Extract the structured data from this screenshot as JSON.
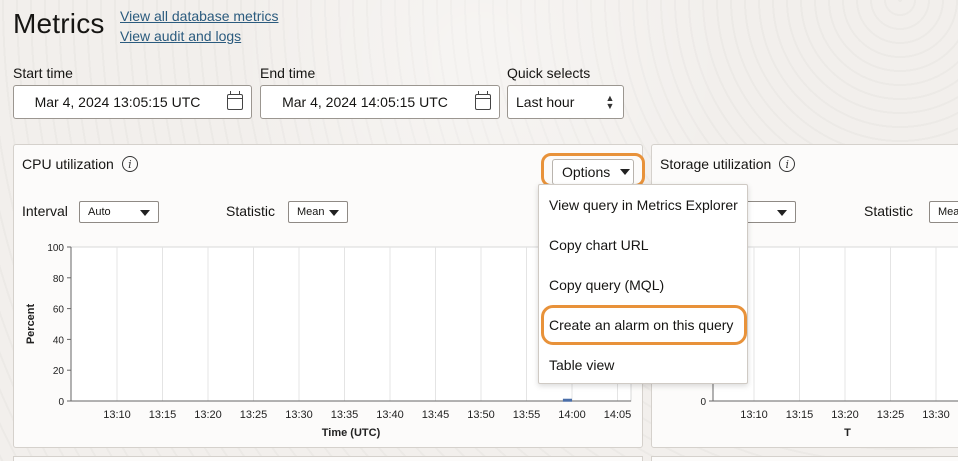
{
  "page": {
    "title": "Metrics",
    "links": [
      "View all database metrics",
      "View audit and logs"
    ]
  },
  "filters": {
    "start_label": "Start time",
    "start_value": "Mar 4, 2024 13:05:15 UTC",
    "end_label": "End time",
    "end_value": "Mar 4, 2024 14:05:15 UTC",
    "quick_label": "Quick selects",
    "quick_value": "Last hour"
  },
  "cpu_panel": {
    "title": "CPU utilization",
    "interval_label": "Interval",
    "interval_value": "Auto",
    "statistic_label": "Statistic",
    "statistic_value": "Mean",
    "options_label": "Options"
  },
  "storage_panel": {
    "title": "Storage utilization",
    "statistic_label": "Statistic",
    "statistic_value": "Mean"
  },
  "options_menu": {
    "items": [
      "View query in Metrics Explorer",
      "Copy chart URL",
      "Copy query (MQL)",
      "Create an alarm on this query",
      "Table view"
    ],
    "highlighted_index": 3
  },
  "icons": {
    "info": "info-icon",
    "calendar": "calendar-icon",
    "caret": "chevron-down-icon"
  },
  "colors": {
    "accent_highlight": "#e8923a",
    "link": "#2b5b7e",
    "series": "#4a6ea8"
  },
  "chart_data": [
    {
      "type": "line",
      "ylabel": "Percent",
      "xlabel": "Time (UTC)",
      "yticks": [
        0,
        20,
        40,
        60,
        80,
        100
      ],
      "ylim": [
        0,
        100
      ],
      "xticks": [
        "13:10",
        "13:15",
        "13:20",
        "13:25",
        "13:30",
        "13:35",
        "13:40",
        "13:45",
        "13:50",
        "13:55",
        "14:00",
        "14:05"
      ],
      "series": [
        {
          "x": [
            "13:59",
            "14:00"
          ],
          "values": [
            0.5,
            0.5
          ]
        }
      ],
      "grid": "vertical"
    },
    {
      "type": "line",
      "ylabel": "",
      "xlabel": "T",
      "yticks": [
        0
      ],
      "xticks": [
        "13:10",
        "13:15",
        "13:20",
        "13:25",
        "13:30"
      ],
      "series": [],
      "grid": "vertical"
    }
  ]
}
